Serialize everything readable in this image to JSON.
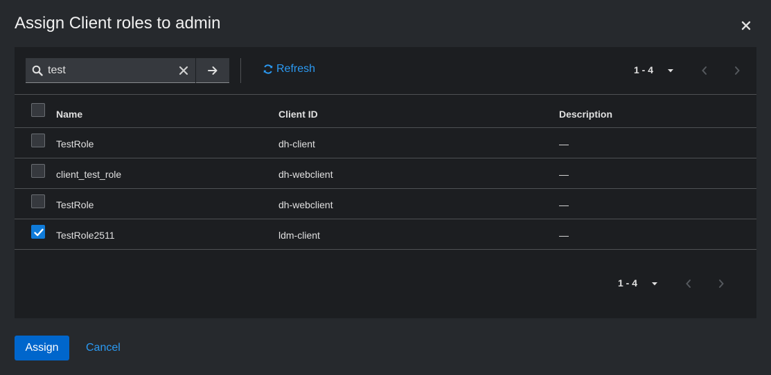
{
  "modal": {
    "title": "Assign Client roles to admin"
  },
  "toolbar": {
    "search_value": "test",
    "refresh_label": "Refresh"
  },
  "pagination": {
    "range": "1 - 4"
  },
  "table": {
    "headers": {
      "name": "Name",
      "client_id": "Client ID",
      "description": "Description"
    },
    "rows": [
      {
        "name": "TestRole",
        "client_id": "dh-client",
        "description": "—",
        "checked": false
      },
      {
        "name": "client_test_role",
        "client_id": "dh-webclient",
        "description": "—",
        "checked": false
      },
      {
        "name": "TestRole",
        "client_id": "dh-webclient",
        "description": "—",
        "checked": false
      },
      {
        "name": "TestRole2511",
        "client_id": "ldm-client",
        "description": "—",
        "checked": true
      }
    ]
  },
  "footer": {
    "assign_label": "Assign",
    "cancel_label": "Cancel"
  },
  "colors": {
    "primary": "#0066cc",
    "link": "#2b9af3",
    "background": "#26292d",
    "panel": "#1c1e21"
  }
}
